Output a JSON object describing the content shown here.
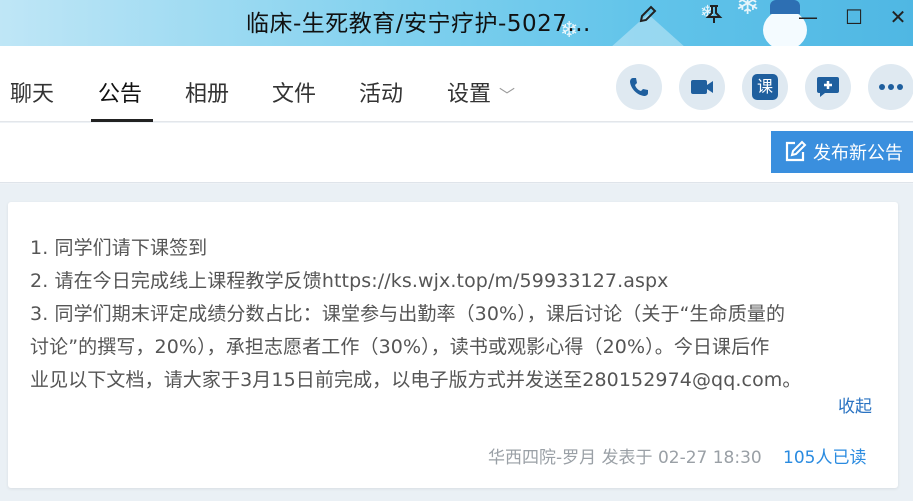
{
  "window": {
    "title": "临床-生死教育/安宁疗护-5027...",
    "edit_icon": "pencil-icon",
    "pin_icon": "pin-icon",
    "minimize_label": "—",
    "maximize_label": "☐",
    "close_label": "✕"
  },
  "tabs": [
    {
      "label": "聊天"
    },
    {
      "label": "公告",
      "active": true
    },
    {
      "label": "相册"
    },
    {
      "label": "文件"
    },
    {
      "label": "活动"
    },
    {
      "label": "设置"
    }
  ],
  "actions": {
    "class_label": "课",
    "icons": [
      "phone-icon",
      "video-icon",
      "class-icon",
      "add-app-icon",
      "more-icon"
    ]
  },
  "toolbar": {
    "publish_label": "发布新公告"
  },
  "announcement": {
    "lines": [
      "1. 同学们请下课签到",
      "2. 请在今日完成线上课程教学反馈https://ks.wjx.top/m/59933127.aspx",
      "3. 同学们期末评定成绩分数占比：课堂参与出勤率（30%），课后讨论（关于“生命质量的",
      "讨论”的撰写，20%），承担志愿者工作（30%），读书或观影心得（20%）。今日课后作",
      "业见以下文档，请大家于3月15日前完成，以电子版方式并发送至280152974@qq.com。"
    ],
    "collapse_label": "收起",
    "meta": "华西四院-罗月 发表于 02-27 18:30",
    "read_count": "105人已读"
  },
  "colors": {
    "accent": "#3a8fde",
    "link": "#2a73c2",
    "read_count": "#2a8be0",
    "icon_blue": "#1f5f9e"
  }
}
